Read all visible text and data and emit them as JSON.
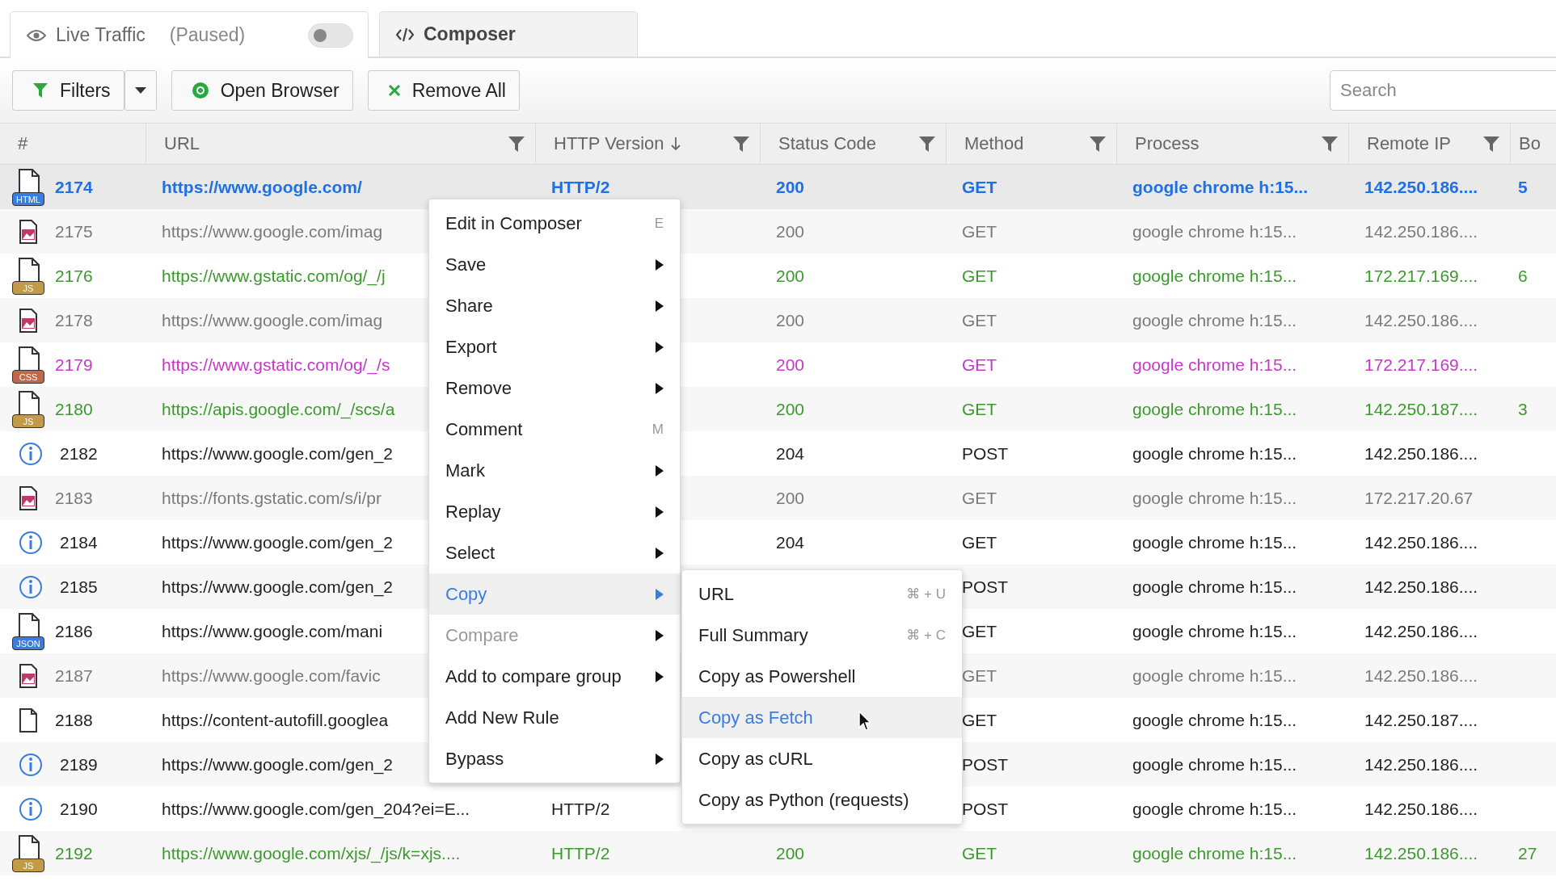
{
  "tabs": [
    {
      "label": "Live Traffic",
      "status": "(Paused)",
      "toggle_on": false,
      "selected": true
    },
    {
      "label": "Composer",
      "selected": false
    }
  ],
  "toolbar": {
    "buttons": [
      {
        "label": "Filters",
        "dropdown": true
      },
      {
        "label": "Open Browser",
        "dropdown": false
      },
      {
        "label": "Remove All",
        "dropdown": false
      }
    ],
    "search": {
      "placeholder": "Search"
    }
  },
  "table": {
    "columns": [
      {
        "label": "#",
        "filter": false,
        "sorted": false
      },
      {
        "label": "URL",
        "filter": true,
        "sorted": false
      },
      {
        "label": "HTTP Version",
        "filter": true,
        "sorted": true
      },
      {
        "label": "Status Code",
        "filter": true,
        "sorted": false
      },
      {
        "label": "Method",
        "filter": true,
        "sorted": false
      },
      {
        "label": "Process",
        "filter": true,
        "sorted": false
      },
      {
        "label": "Remote IP",
        "filter": true,
        "sorted": false
      },
      {
        "label": "Bo"
      }
    ],
    "rows": [
      {
        "kind": "file",
        "badge": "HTML",
        "color": "#1f6fe5",
        "selected": true,
        "cells": [
          "2174",
          "https://www.google.com/",
          "HTTP/2",
          "200",
          "GET",
          "google chrome h:15...",
          "142.250.186....",
          "5"
        ]
      },
      {
        "kind": "image",
        "color": "#7a7a7a",
        "selected": false,
        "cells": [
          "2175",
          "https://www.google.com/imag",
          null,
          "200",
          "GET",
          "google chrome h:15...",
          "142.250.186....",
          null
        ]
      },
      {
        "kind": "file",
        "badge": "JS",
        "color": "#3b9a2c",
        "selected": false,
        "cells": [
          "2176",
          "https://www.gstatic.com/og/_/j",
          null,
          "200",
          "GET",
          "google chrome h:15...",
          "172.217.169....",
          "6"
        ]
      },
      {
        "kind": "image",
        "color": "#7a7a7a",
        "selected": false,
        "cells": [
          "2178",
          "https://www.google.com/imag",
          null,
          "200",
          "GET",
          "google chrome h:15...",
          "142.250.186....",
          null
        ]
      },
      {
        "kind": "file",
        "badge": "CSS",
        "color": "#c737c9",
        "selected": false,
        "cells": [
          "2179",
          "https://www.gstatic.com/og/_/s",
          null,
          "200",
          "GET",
          "google chrome h:15...",
          "172.217.169....",
          null
        ]
      },
      {
        "kind": "file",
        "badge": "JS",
        "color": "#3b9a2c",
        "selected": false,
        "cells": [
          "2180",
          "https://apis.google.com/_/scs/a",
          null,
          "200",
          "GET",
          "google chrome h:15...",
          "142.250.187....",
          "3"
        ]
      },
      {
        "kind": "info",
        "color": "#222222",
        "selected": false,
        "cells": [
          "2182",
          "https://www.google.com/gen_2",
          null,
          "204",
          "POST",
          "google chrome h:15...",
          "142.250.186....",
          null
        ]
      },
      {
        "kind": "image",
        "color": "#7a7a7a",
        "selected": false,
        "cells": [
          "2183",
          "https://fonts.gstatic.com/s/i/pr",
          null,
          "200",
          "GET",
          "google chrome h:15...",
          "172.217.20.67",
          null
        ]
      },
      {
        "kind": "info",
        "color": "#222222",
        "selected": false,
        "cells": [
          "2184",
          "https://www.google.com/gen_2",
          null,
          "204",
          "GET",
          "google chrome h:15...",
          "142.250.186....",
          null
        ]
      },
      {
        "kind": "info",
        "color": "#222222",
        "selected": false,
        "cells": [
          "2185",
          "https://www.google.com/gen_2",
          null,
          null,
          "POST",
          "google chrome h:15...",
          "142.250.186....",
          null
        ]
      },
      {
        "kind": "file",
        "badge": "JSON",
        "color": "#222222",
        "selected": false,
        "cells": [
          "2186",
          "https://www.google.com/mani",
          null,
          null,
          "GET",
          "google chrome h:15...",
          "142.250.186....",
          null
        ]
      },
      {
        "kind": "image",
        "color": "#7a7a7a",
        "selected": false,
        "cells": [
          "2187",
          "https://www.google.com/favic",
          null,
          null,
          "GET",
          "google chrome h:15...",
          "142.250.186....",
          null
        ]
      },
      {
        "kind": "plain",
        "color": "#222222",
        "selected": false,
        "cells": [
          "2188",
          "https://content-autofill.googlea",
          null,
          null,
          "GET",
          "google chrome h:15...",
          "142.250.187....",
          null
        ]
      },
      {
        "kind": "info",
        "color": "#222222",
        "selected": false,
        "cells": [
          "2189",
          "https://www.google.com/gen_2",
          null,
          null,
          "POST",
          "google chrome h:15...",
          "142.250.186....",
          null
        ]
      },
      {
        "kind": "info",
        "color": "#222222",
        "selected": false,
        "cells": [
          "2190",
          "https://www.google.com/gen_204?ei=E...",
          "HTTP/2",
          null,
          "POST",
          "google chrome h:15...",
          "142.250.186....",
          null
        ]
      },
      {
        "kind": "file",
        "badge": "JS",
        "color": "#3b9a2c",
        "selected": false,
        "cells": [
          "2192",
          "https://www.google.com/xjs/_/js/k=xjs....",
          "HTTP/2",
          "200",
          "GET",
          "google chrome h:15...",
          "142.250.186....",
          "27"
        ]
      }
    ]
  },
  "context_menu": {
    "items": [
      {
        "label": "Edit in Composer",
        "shortcut": "E",
        "submenu": false,
        "disabled": false,
        "selected": false
      },
      {
        "label": "Save",
        "submenu": true,
        "disabled": false,
        "selected": false
      },
      {
        "label": "Share",
        "submenu": true,
        "disabled": false,
        "selected": false
      },
      {
        "label": "Export",
        "submenu": true,
        "disabled": false,
        "selected": false
      },
      {
        "label": "Remove",
        "submenu": true,
        "disabled": false,
        "selected": false
      },
      {
        "label": "Comment",
        "shortcut": "M",
        "submenu": false,
        "disabled": false,
        "selected": false
      },
      {
        "label": "Mark",
        "submenu": true,
        "disabled": false,
        "selected": false
      },
      {
        "label": "Replay",
        "submenu": true,
        "disabled": false,
        "selected": false
      },
      {
        "label": "Select",
        "submenu": true,
        "disabled": false,
        "selected": false
      },
      {
        "label": "Copy",
        "submenu": true,
        "disabled": false,
        "selected": true
      },
      {
        "label": "Compare",
        "submenu": true,
        "disabled": true,
        "selected": false
      },
      {
        "label": "Add to compare group",
        "submenu": true,
        "disabled": false,
        "selected": false
      },
      {
        "label": "Add New Rule",
        "submenu": false,
        "disabled": false,
        "selected": false
      },
      {
        "label": "Bypass",
        "submenu": true,
        "disabled": false,
        "selected": false
      }
    ]
  },
  "copy_submenu": {
    "items": [
      {
        "label": "URL",
        "shortcut": "⌘ + U",
        "selected": false
      },
      {
        "label": "Full Summary",
        "shortcut": "⌘ + C",
        "selected": false
      },
      {
        "label": "Copy as Powershell",
        "selected": false
      },
      {
        "label": "Copy as Fetch",
        "selected": true
      },
      {
        "label": "Copy as cURL",
        "selected": false
      },
      {
        "label": "Copy as Python (requests)",
        "selected": false
      }
    ]
  }
}
